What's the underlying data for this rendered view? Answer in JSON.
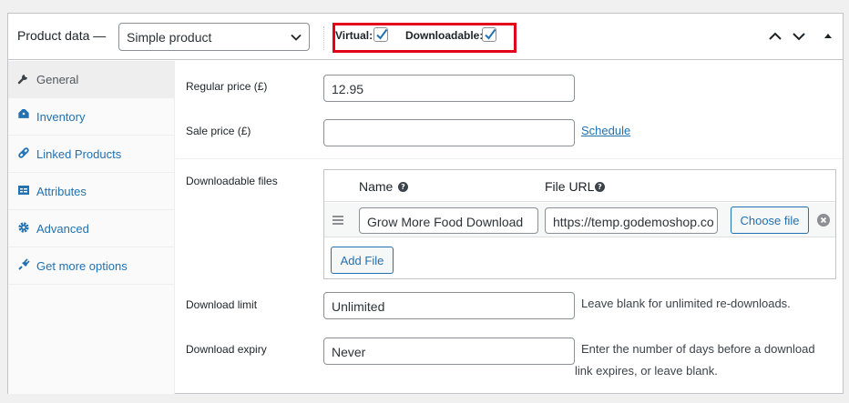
{
  "header": {
    "title": "Product data —",
    "product_type": "Simple product",
    "virtual_label": "Virtual:",
    "virtual_checked": true,
    "downloadable_label": "Downloadable:",
    "downloadable_checked": true,
    "highlight_color": "#e3001b"
  },
  "sidebar": {
    "items": [
      {
        "label": "General",
        "icon": "wrench-icon",
        "active": true
      },
      {
        "label": "Inventory",
        "icon": "tag-icon",
        "active": false
      },
      {
        "label": "Linked Products",
        "icon": "link-icon",
        "active": false
      },
      {
        "label": "Attributes",
        "icon": "table-icon",
        "active": false
      },
      {
        "label": "Advanced",
        "icon": "gear-icon",
        "active": false
      },
      {
        "label": "Get more options",
        "icon": "plugin-icon",
        "active": false
      }
    ]
  },
  "general": {
    "regular_price_label": "Regular price (£)",
    "regular_price_value": "12.95",
    "sale_price_label": "Sale price (£)",
    "sale_price_value": "",
    "schedule_link": "Schedule"
  },
  "downloads": {
    "label": "Downloadable files",
    "col_name": "Name",
    "col_url": "File URL",
    "files": [
      {
        "name": "Grow More Food Download",
        "url": "https://temp.godemoshop.co"
      }
    ],
    "choose_file_label": "Choose file",
    "add_file_label": "Add File",
    "limit_label": "Download limit",
    "limit_value": "Unlimited",
    "limit_hint": "Leave blank for unlimited re-downloads.",
    "expiry_label": "Download expiry",
    "expiry_value": "Never",
    "expiry_hint": "Enter the number of days before a download link expires, or leave blank."
  },
  "colors": {
    "link": "#2271b1",
    "border": "#c3c4c7"
  }
}
